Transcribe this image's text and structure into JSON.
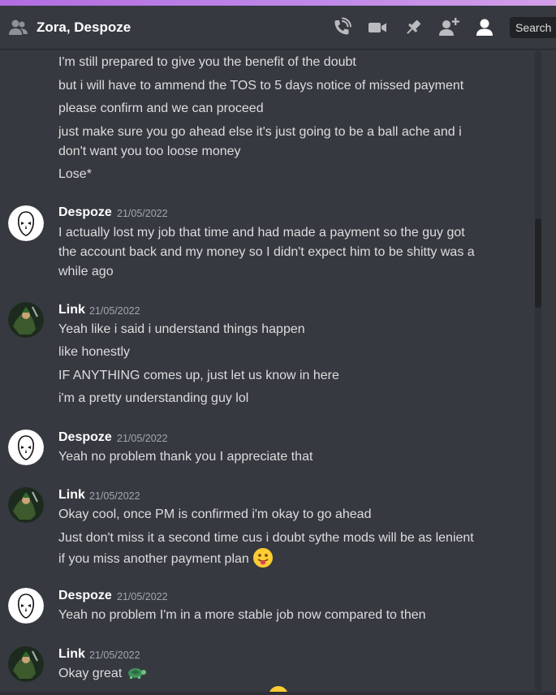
{
  "header": {
    "title": "Zora, Despoze",
    "search_label": "Search"
  },
  "icons": {
    "people": "people-icon",
    "call": "phone-call-icon",
    "video": "video-camera-icon",
    "pin": "pin-icon",
    "add_friend": "add-friend-icon",
    "members": "members-icon",
    "emoji_tongue": "face-with-tongue-emoji",
    "emoji_turtle": "turtle-emoji"
  },
  "colors": {
    "background": "#36393f",
    "text": "#dcddde",
    "author": "#ffffff",
    "timestamp": "#a3a6aa",
    "top_strip": "#c08ae8"
  },
  "messages": {
    "g0": {
      "lines": [
        "I'm still prepared to give you the benefit of the doubt",
        "but i will have to ammend the TOS to 5 days notice of missed payment",
        "please confirm and we can proceed",
        "just make sure you go ahead else it's just going to be a ball ache and i",
        "don't want you too loose money",
        "Lose*"
      ]
    },
    "g1": {
      "author": "Despoze",
      "time": "21/05/2022",
      "lines": [
        "I actually lost my job that time and had made a payment so the guy got",
        "the account back and my money so I didn't expect him to be shitty was a",
        "while ago"
      ]
    },
    "g2": {
      "author": "Link",
      "time": "21/05/2022",
      "lines": [
        "Yeah like i said i understand things happen",
        "like honestly",
        "IF ANYTHING comes up, just let us know in here",
        "i'm a pretty understanding guy lol"
      ]
    },
    "g3": {
      "author": "Despoze",
      "time": "21/05/2022",
      "lines": [
        "Yeah no problem thank you I appreciate that"
      ]
    },
    "g4": {
      "author": "Link",
      "time": "21/05/2022",
      "lines": [
        "Okay cool, once PM is confirmed i'm okay to go ahead",
        "Just don't miss it a second time cus i doubt sythe mods will be as lenient",
        "if you miss another payment plan"
      ]
    },
    "g5": {
      "author": "Despoze",
      "time": "21/05/2022",
      "lines": [
        "Yeah no problem I'm in a more stable job now compared to then"
      ]
    },
    "g6": {
      "author": "Link",
      "time": "21/05/2022",
      "lines": [
        "Okay great"
      ]
    }
  }
}
